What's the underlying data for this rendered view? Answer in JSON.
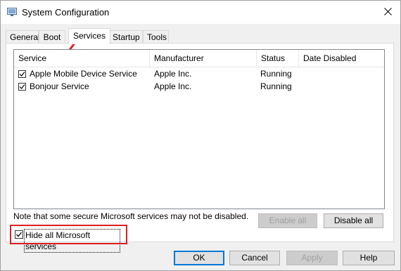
{
  "window": {
    "title": "System Configuration",
    "icons": {
      "app": "system-config-icon",
      "close": "close-icon"
    }
  },
  "tabs": [
    {
      "label": "General",
      "active": false
    },
    {
      "label": "Boot",
      "active": false
    },
    {
      "label": "Services",
      "active": true
    },
    {
      "label": "Startup",
      "active": false
    },
    {
      "label": "Tools",
      "active": false
    }
  ],
  "services_table": {
    "columns": [
      "Service",
      "Manufacturer",
      "Status",
      "Date Disabled"
    ],
    "rows": [
      {
        "checked": true,
        "service": "Apple Mobile Device Service",
        "manufacturer": "Apple Inc.",
        "status": "Running",
        "date_disabled": ""
      },
      {
        "checked": true,
        "service": "Bonjour Service",
        "manufacturer": "Apple Inc.",
        "status": "Running",
        "date_disabled": ""
      }
    ]
  },
  "note": "Note that some secure Microsoft services may not be disabled.",
  "buttons": {
    "enable_all": "Enable all",
    "disable_all": "Disable all",
    "ok": "OK",
    "cancel": "Cancel",
    "apply": "Apply",
    "help": "Help"
  },
  "hide_microsoft": {
    "label": "Hide all Microsoft services",
    "checked": true
  },
  "colors": {
    "annotation": "#e02020",
    "focus": "#0078d7"
  }
}
